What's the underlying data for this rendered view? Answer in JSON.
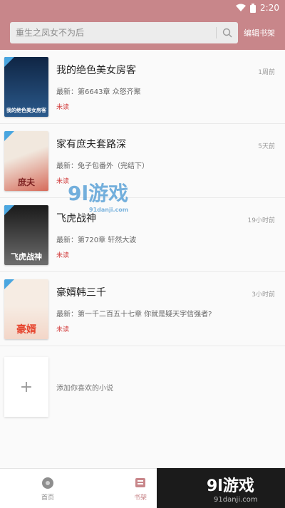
{
  "status_bar": {
    "time": "2:20"
  },
  "header": {
    "search_placeholder": "重生之凤女不为后",
    "edit_label": "编辑书架"
  },
  "books": [
    {
      "title": "我的绝色美女房客",
      "latest_prefix": "最新：",
      "latest_chapter": "第6643章 众怒齐聚",
      "status": "未读",
      "time": "1周前",
      "cover_caption": "我的绝色美女房客",
      "cover_colors": [
        "#0f2544",
        "#2b5a8c"
      ]
    },
    {
      "title": "家有庶夫套路深",
      "latest_prefix": "最新：",
      "latest_chapter": "兔子包番外（完结下）",
      "status": "未读",
      "time": "5天前",
      "cover_caption": "庶夫",
      "cover_colors": [
        "#f1e8de",
        "#d66b5a"
      ]
    },
    {
      "title": "飞虎战神",
      "latest_prefix": "最新：",
      "latest_chapter": "第720章 轩然大波",
      "status": "未读",
      "time": "19小时前",
      "cover_caption": "飞虎战神",
      "cover_colors": [
        "#1a1a1a",
        "#6d6d6d"
      ]
    },
    {
      "title": "豪婿韩三千",
      "latest_prefix": "最新：",
      "latest_chapter": "第一千二百五十七章 你就是疑天宇信强者?",
      "status": "未读",
      "time": "3小时前",
      "cover_caption": "豪婿",
      "cover_colors": [
        "#f6ece3",
        "#e6452f"
      ]
    }
  ],
  "add_row": {
    "plus": "+",
    "label": "添加你喜欢的小说"
  },
  "tabbar": {
    "tabs": [
      {
        "label": "首页"
      },
      {
        "label": "书架"
      }
    ]
  },
  "watermarks": {
    "mid_big": "9l游戏",
    "mid_small": "91danji.com",
    "bottom_big": "9l游戏",
    "bottom_url": "91danji.com"
  },
  "colors": {
    "accent": "#c8868a",
    "unread": "#d23b3b",
    "tag": "#4aa6e0"
  }
}
